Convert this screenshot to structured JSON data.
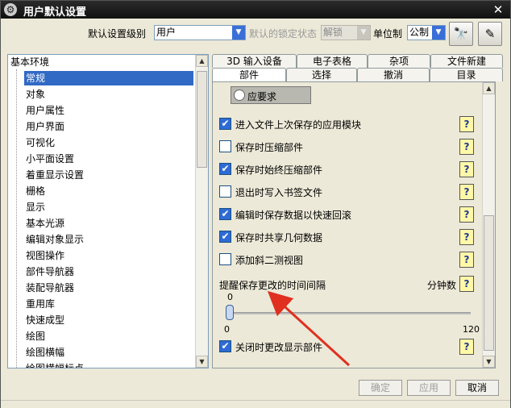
{
  "window": {
    "title": "用户默认设置"
  },
  "toolbar": {
    "level_label": "默认设置级别",
    "level_value": "用户",
    "lock_label": "默认的锁定状态",
    "lock_value": "解锁",
    "unit_label": "单位制",
    "unit_value": "公制"
  },
  "tree": {
    "root": "基本环境",
    "items": [
      "常规",
      "对象",
      "用户属性",
      "用户界面",
      "可视化",
      "小平面设置",
      "着重显示设置",
      "栅格",
      "显示",
      "基本光源",
      "编辑对象显示",
      "视图操作",
      "部件导航器",
      "装配导航器",
      "重用库",
      "快速成型",
      "绘图",
      "绘图横幅",
      "绘图横幅标点"
    ]
  },
  "tabs": {
    "back_row": [
      "3D 输入设备",
      "电子表格",
      "杂项",
      "文件新建"
    ],
    "front_row": [
      "部件",
      "选择",
      "撤消",
      "目录"
    ]
  },
  "panel": {
    "radio_label": "应要求",
    "options": [
      {
        "label": "进入文件上次保存的应用模块",
        "checked": true
      },
      {
        "label": "保存时压缩部件",
        "checked": false
      },
      {
        "label": "保存时始终压缩部件",
        "checked": true
      },
      {
        "label": "退出时写入书签文件",
        "checked": false
      },
      {
        "label": "编辑时保存数据以快速回滚",
        "checked": true
      },
      {
        "label": "保存时共享几何数据",
        "checked": true
      },
      {
        "label": "添加斜二测视图",
        "checked": false
      }
    ],
    "slider": {
      "title": "提醒保存更改的时间间隔",
      "unit": "分钟数",
      "value": "0",
      "min": "0",
      "max": "120"
    },
    "last_option": {
      "label": "关闭时更改显示部件",
      "checked": true
    },
    "help_glyph": "?"
  },
  "buttons": {
    "ok": "确定",
    "apply": "应用",
    "cancel": "取消"
  },
  "colors": {
    "annotation_arrow": "#e03020",
    "selection": "#316ac5",
    "checkbox": "#2e6bd6"
  }
}
